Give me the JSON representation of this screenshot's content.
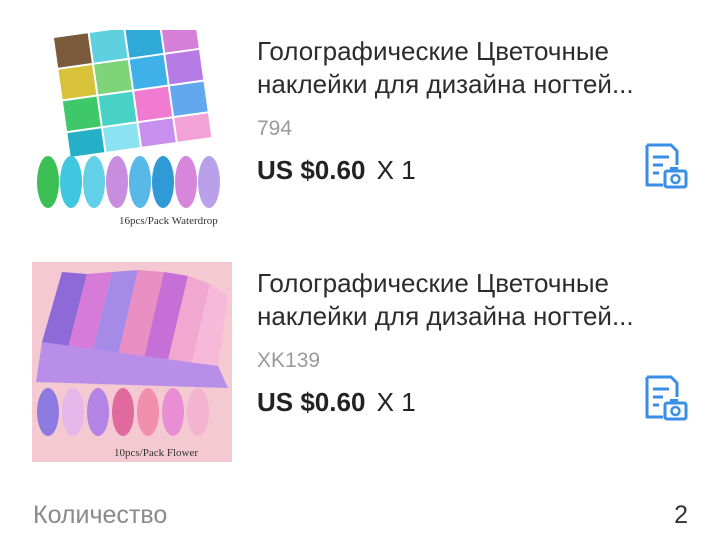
{
  "items": [
    {
      "title": "Голографические Цветочные наклейки для дизайна ногтей...",
      "sku": "794",
      "price": "US $0.60",
      "quantity_text": "X 1",
      "image_caption": "16pcs/Pack Waterdrop",
      "action_icon": "photo-review-icon"
    },
    {
      "title": "Голографические Цветочные наклейки для дизайна ногтей...",
      "sku": "XK139",
      "price": "US $0.60",
      "quantity_text": "X 1",
      "image_caption": "10pcs/Pack Flower",
      "action_icon": "photo-review-icon"
    }
  ],
  "summary": {
    "label": "Количество",
    "value": "2"
  },
  "colors": {
    "accent_blue": "#3a8ee6",
    "sku_gray": "#9a9a9a",
    "label_gray": "#8a8a8a"
  }
}
